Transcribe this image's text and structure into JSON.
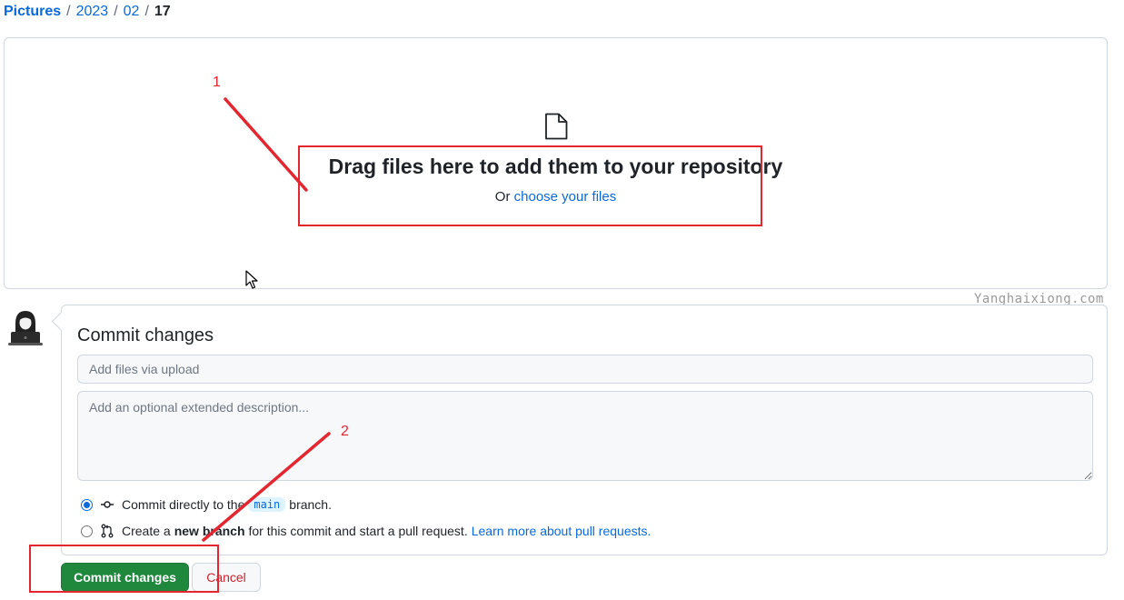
{
  "breadcrumb": {
    "root": "Pictures",
    "segments": [
      "2023",
      "02"
    ],
    "current": "17",
    "separator": "/"
  },
  "dropzone": {
    "icon": "file-icon",
    "title": "Drag files here to add them to your repository",
    "or_text": "Or",
    "choose_link": "choose your files"
  },
  "watermark": "Yanghaixiong.com",
  "commit": {
    "title": "Commit changes",
    "summary_placeholder": "Add files via upload",
    "description_placeholder": "Add an optional extended description...",
    "option_direct": {
      "text_before": "Commit directly to the",
      "branch": "main",
      "text_after": "branch.",
      "checked": true,
      "icon": "git-commit-icon"
    },
    "option_new_branch": {
      "text_before": "Create a",
      "bold": "new branch",
      "text_after": "for this commit and start a pull request.",
      "link": "Learn more about pull requests.",
      "checked": false,
      "icon": "git-pull-request-icon"
    },
    "commit_button": "Commit changes",
    "cancel_button": "Cancel"
  },
  "annotations": {
    "color": "#e3262f",
    "labels": [
      "1",
      "2"
    ]
  },
  "colors": {
    "accent": "#0969da",
    "primary_button": "#1f883d",
    "danger": "#cf222e",
    "border": "#d0d7de"
  }
}
